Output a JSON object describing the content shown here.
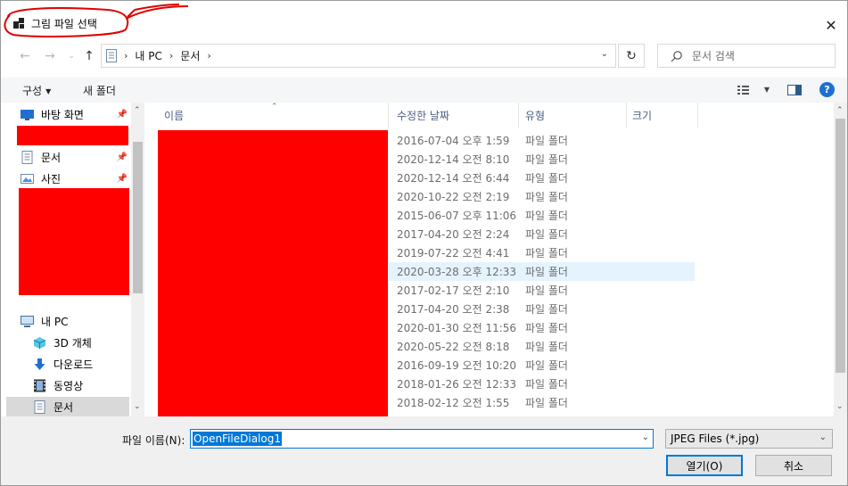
{
  "window": {
    "title": "그림 파일 선택",
    "close_glyph": "✕"
  },
  "address": {
    "crumbs": [
      "내 PC",
      "문서"
    ],
    "search_placeholder": "문서 검색"
  },
  "toolbar": {
    "organize_label": "구성",
    "new_folder_label": "새 폴더"
  },
  "nav": {
    "items": [
      {
        "label": "바탕 화면",
        "icon": "desktop-icon",
        "pinned": true
      },
      {
        "label": "문서",
        "icon": "document-icon",
        "pinned": true
      },
      {
        "label": "사진",
        "icon": "picture-icon",
        "pinned": true
      },
      {
        "label": "내 PC",
        "icon": "pc-icon"
      },
      {
        "label": "3D 개체",
        "icon": "cube-icon"
      },
      {
        "label": "다운로드",
        "icon": "download-icon"
      },
      {
        "label": "동영상",
        "icon": "video-icon"
      },
      {
        "label": "문서",
        "icon": "document-icon",
        "selected": true
      }
    ]
  },
  "list": {
    "columns": [
      "이름",
      "수정한 날짜",
      "유형",
      "크기"
    ],
    "rows": [
      {
        "date": "2016-07-04 오후 1:59",
        "type": "파일 폴더"
      },
      {
        "date": "2020-12-14 오전 8:10",
        "type": "파일 폴더"
      },
      {
        "date": "2020-12-14 오전 6:44",
        "type": "파일 폴더"
      },
      {
        "date": "2020-10-22 오전 2:19",
        "type": "파일 폴더"
      },
      {
        "date": "2015-06-07 오후 11:06",
        "type": "파일 폴더"
      },
      {
        "date": "2017-04-20 오전 2:24",
        "type": "파일 폴더"
      },
      {
        "date": "2019-07-22 오전 4:41",
        "type": "파일 폴더"
      },
      {
        "date": "2020-03-28 오후 12:33",
        "type": "파일 폴더",
        "hover": true
      },
      {
        "date": "2017-02-17 오전 2:10",
        "type": "파일 폴더"
      },
      {
        "date": "2017-04-20 오전 2:38",
        "type": "파일 폴더"
      },
      {
        "date": "2020-01-30 오전 11:56",
        "type": "파일 폴더"
      },
      {
        "date": "2020-05-22 오전 8:18",
        "type": "파일 폴더"
      },
      {
        "date": "2016-09-19 오전 10:20",
        "type": "파일 폴더"
      },
      {
        "date": "2018-01-26 오전 12:33",
        "type": "파일 폴더"
      },
      {
        "date": "2018-02-12 오전 1:55",
        "type": "파일 폴더"
      }
    ]
  },
  "bottom": {
    "filename_label": "파일 이름(N):",
    "filename_value": "OpenFileDialog1",
    "filter_value": "JPEG Files (*.jpg)",
    "open_label": "열기(O)",
    "cancel_label": "취소"
  },
  "colors": {
    "accent": "#0078d7",
    "annotation": "#e00000",
    "redaction": "#ff0000"
  }
}
